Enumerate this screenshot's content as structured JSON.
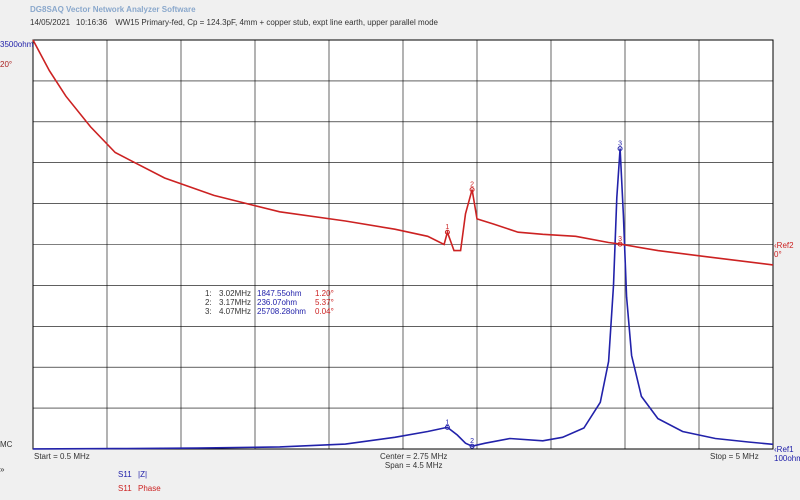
{
  "header": {
    "app_title": "DG8SAQ Vector Network Analyzer Software",
    "date": "14/05/2021",
    "time": "10:16:36",
    "description": "WW15 Primary-fed, Cp = 124.3pF, 4mm + copper stub, expt line earth, upper parallel mode"
  },
  "axis_labels": {
    "top_left_mag": "3500ohm",
    "top_left_phase": "20°",
    "mc": "MC",
    "arrows": "»",
    "ref2": "Ref2",
    "ref2_val": "0°",
    "ref1": "Ref1",
    "ref1_val": "100ohm",
    "start": "Start = 0.5 MHz",
    "center": "Center = 2.75 MHz",
    "span": "Span = 4.5 MHz",
    "stop": "Stop = 5 MHz"
  },
  "legend": [
    {
      "s": "S11",
      "name": "|Z|",
      "color": "#2222aa"
    },
    {
      "s": "S11",
      "name": "Phase",
      "color": "#cc2222"
    }
  ],
  "markers": [
    {
      "num": "1:",
      "freq": "3.02MHz",
      "mag": "1847.55ohm",
      "phase": "1.20°"
    },
    {
      "num": "2:",
      "freq": "3.17MHz",
      "mag": "236.07ohm",
      "phase": "5.37°"
    },
    {
      "num": "3:",
      "freq": "4.07MHz",
      "mag": "25708.28ohm",
      "phase": "0.04°"
    }
  ],
  "chart_data": {
    "type": "line",
    "x_unit": "MHz",
    "xlim": [
      0.5,
      5.0
    ],
    "series": [
      {
        "name": "|Z|",
        "color": "#2222aa",
        "ylim": [
          0,
          35000
        ],
        "x": [
          0.5,
          1.0,
          1.5,
          2.0,
          2.4,
          2.7,
          2.9,
          3.0,
          3.02,
          3.08,
          3.13,
          3.17,
          3.25,
          3.4,
          3.6,
          3.72,
          3.85,
          3.95,
          4.0,
          4.03,
          4.05,
          4.07,
          4.09,
          4.11,
          4.14,
          4.2,
          4.3,
          4.45,
          4.65,
          4.85,
          5.0
        ],
        "y": [
          10,
          30,
          80,
          180,
          420,
          1000,
          1500,
          1800,
          1848,
          1200,
          500,
          236,
          500,
          900,
          700,
          1000,
          1800,
          4000,
          7500,
          14000,
          21500,
          25708,
          20000,
          13000,
          8000,
          4500,
          2600,
          1500,
          900,
          600,
          400
        ]
      },
      {
        "name": "Phase",
        "color": "#cc2222",
        "ylim": [
          -20,
          20
        ],
        "x": [
          0.5,
          0.6,
          0.7,
          0.85,
          1.0,
          1.3,
          1.6,
          2.0,
          2.4,
          2.7,
          2.9,
          3.0,
          3.02,
          3.06,
          3.1,
          3.13,
          3.17,
          3.2,
          3.3,
          3.45,
          3.6,
          3.8,
          4.0,
          4.07,
          4.3,
          4.6,
          5.0
        ],
        "y": [
          20,
          17,
          14.5,
          11.5,
          9,
          6.5,
          4.8,
          3.2,
          2.3,
          1.5,
          0.8,
          0,
          1.2,
          -0.6,
          -0.6,
          3.0,
          5.37,
          2.5,
          2.0,
          1.2,
          1.0,
          0.8,
          0.2,
          0.04,
          -0.6,
          -1.2,
          -2.0
        ]
      }
    ],
    "grid": true,
    "markers": [
      {
        "label": "1",
        "x": 3.02
      },
      {
        "label": "2",
        "x": 3.17
      },
      {
        "label": "3",
        "x": 4.07
      }
    ]
  }
}
